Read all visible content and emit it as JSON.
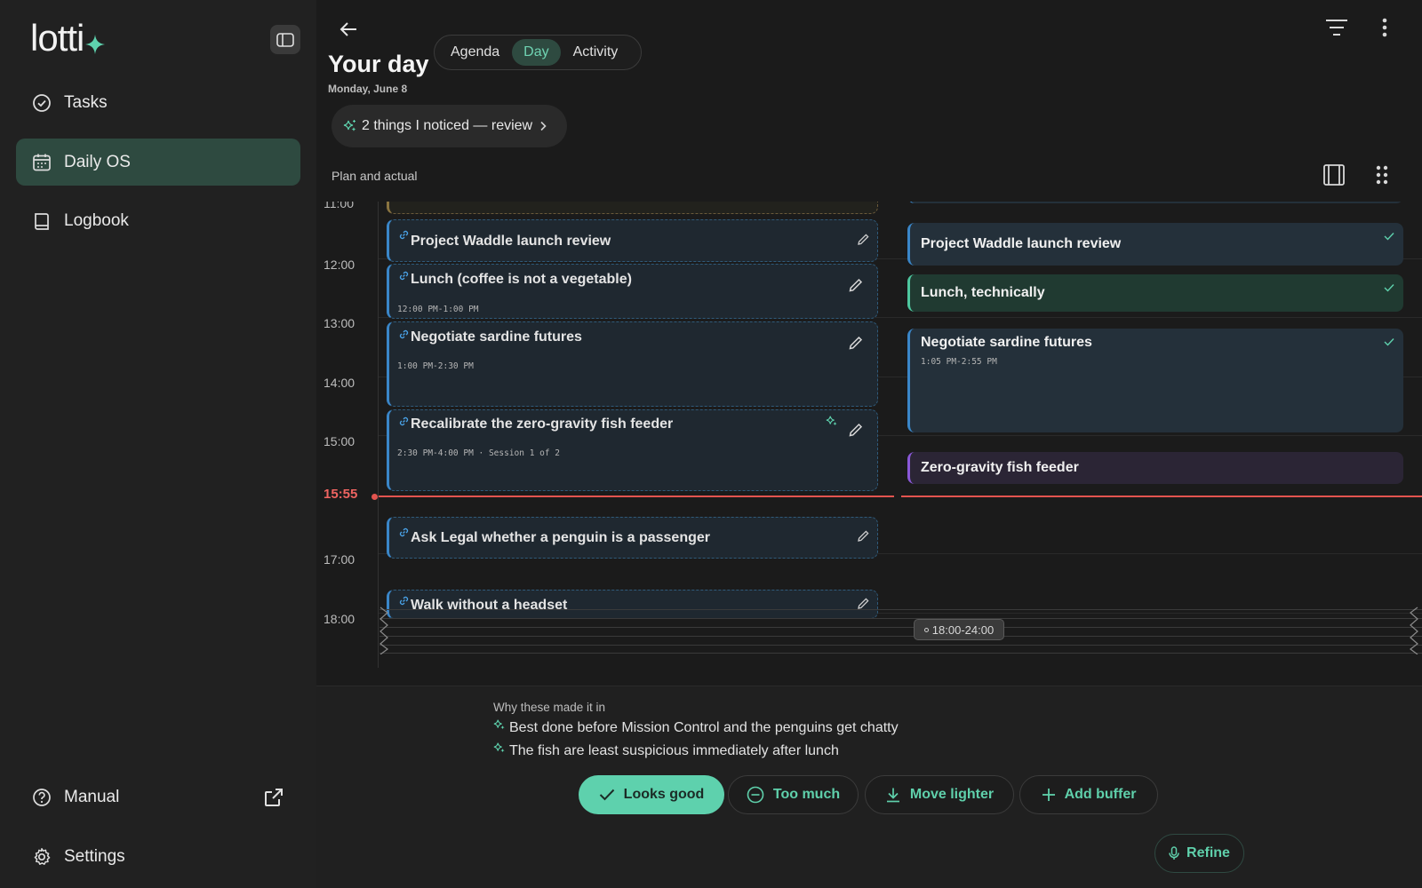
{
  "app": {
    "logo_text": "lotti",
    "accent": "#5ed1ad"
  },
  "sidebar": {
    "items": [
      {
        "label": "Tasks",
        "icon": "check-circle-icon",
        "active": false
      },
      {
        "label": "Daily OS",
        "icon": "calendar-icon",
        "active": true
      },
      {
        "label": "Logbook",
        "icon": "book-icon",
        "active": false
      }
    ],
    "footer": [
      {
        "label": "Manual",
        "icon": "help-circle-icon"
      },
      {
        "label": "Settings",
        "icon": "gear-icon"
      }
    ]
  },
  "header": {
    "title": "Your day",
    "date": "Monday, June 8",
    "tabs": [
      {
        "label": "Agenda",
        "active": false
      },
      {
        "label": "Day",
        "active": true
      },
      {
        "label": "Activity",
        "active": false
      }
    ],
    "notice": "2 things I noticed — review",
    "section_label": "Plan and actual"
  },
  "timeline": {
    "hours": [
      "11:00",
      "12:00",
      "13:00",
      "14:00",
      "15:00",
      "17:00",
      "18:00"
    ],
    "now_label": "15:55",
    "collapsed_range": "18:00-24:00",
    "plan": [
      {
        "title": "Project Waddle launch review",
        "time": ""
      },
      {
        "title": "Lunch (coffee is not a vegetable)",
        "time": "12:00 PM-1:00 PM"
      },
      {
        "title": "Negotiate sardine futures",
        "time": "1:00 PM-2:30 PM"
      },
      {
        "title": "Recalibrate the zero-gravity fish feeder",
        "time": "2:30 PM-4:00 PM · Session 1 of 2"
      },
      {
        "title": "Ask Legal whether a penguin is a passenger",
        "time": ""
      },
      {
        "title": "Walk without a headset",
        "time": ""
      }
    ],
    "actual": [
      {
        "title": "Project Waddle launch review",
        "time": "",
        "color": "#24303a",
        "bar": "#3a86c8",
        "done": true
      },
      {
        "title": "Lunch, technically",
        "time": "",
        "color": "#203a31",
        "bar": "#4ec79f",
        "done": true
      },
      {
        "title": "Negotiate sardine futures",
        "time": "1:05 PM-2:55 PM",
        "color": "#24303a",
        "bar": "#3a86c8",
        "done": true
      },
      {
        "title": "Zero-gravity fish feeder",
        "time": "",
        "color": "#2b2535",
        "bar": "#8a58d8",
        "done": false
      }
    ]
  },
  "review": {
    "why_label": "Why these made it in",
    "reasons": [
      "Best done before Mission Control and the penguins get chatty",
      "The fish are least suspicious immediately after lunch"
    ],
    "actions": {
      "looks_good": "Looks good",
      "too_much": "Too much",
      "move_lighter": "Move lighter",
      "add_buffer": "Add buffer"
    },
    "refine": "Refine"
  }
}
